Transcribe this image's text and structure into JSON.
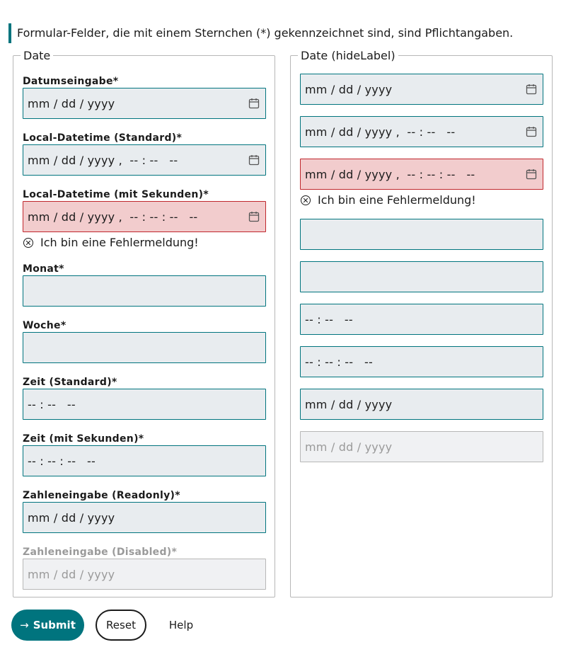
{
  "notice": "Formular-Felder, die mit einem Sternchen (*) gekennzeichnet sind, sind Pflichtangaben.",
  "left": {
    "legend": "Date",
    "fields": [
      {
        "label": "Datumseingabe*",
        "value": "mm / dd / yyyy",
        "icon": "calendar-icon"
      },
      {
        "label": "Local-Datetime (Standard)*",
        "value": "mm / dd / yyyy ,  -- : --   --",
        "icon": "calendar-icon"
      },
      {
        "label": "Local-Datetime (mit Sekunden)*",
        "value": "mm / dd / yyyy ,  -- : -- : --   --",
        "icon": "calendar-icon",
        "error": "Ich bin eine Fehlermeldung!"
      },
      {
        "label": "Monat*",
        "value": ""
      },
      {
        "label": "Woche*",
        "value": ""
      },
      {
        "label": "Zeit (Standard)*",
        "value": "-- : --   --"
      },
      {
        "label": "Zeit (mit Sekunden)*",
        "value": "-- : -- : --   --"
      },
      {
        "label": "Zahleneingabe (Readonly)*",
        "value": "mm / dd / yyyy"
      },
      {
        "label": "Zahleneingabe (Disabled)*",
        "value": "mm / dd / yyyy"
      }
    ]
  },
  "right": {
    "legend": "Date (hideLabel)",
    "fields": [
      {
        "value": "mm / dd / yyyy",
        "icon": "calendar-icon"
      },
      {
        "value": "mm / dd / yyyy ,  -- : --   --",
        "icon": "calendar-icon"
      },
      {
        "value": "mm / dd / yyyy ,  -- : -- : --   --",
        "icon": "calendar-icon",
        "error": "Ich bin eine Fehlermeldung!"
      },
      {
        "value": ""
      },
      {
        "value": ""
      },
      {
        "value": "-- : --   --"
      },
      {
        "value": "-- : -- : --   --"
      },
      {
        "value": "mm / dd / yyyy"
      },
      {
        "value": "mm / dd / yyyy"
      }
    ]
  },
  "buttons": {
    "submit": "Submit",
    "reset": "Reset",
    "help": "Help"
  },
  "colors": {
    "accent": "#00747e",
    "error_bg": "#f2cccd",
    "error_border": "#c0272d",
    "field_bg": "#e8ecef"
  }
}
